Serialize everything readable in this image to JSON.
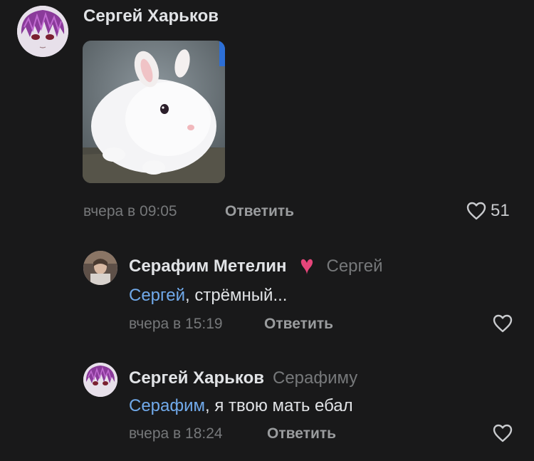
{
  "colors": {
    "background": "#19191a",
    "text": "#e1e3e6",
    "secondary": "#76787a",
    "link": "#71aaeb",
    "heart_badge": "#e6457a"
  },
  "comments": [
    {
      "author": "Сергей Харьков",
      "reply_to": "",
      "mention": "",
      "text": "",
      "has_photo": true,
      "photo_subject": "white-rabbit",
      "time": "вчера в 09:05",
      "reply_label": "Ответить",
      "likes": "51",
      "icon": "heart-outline-icon"
    },
    {
      "author": "Серафим Метелин",
      "badge_icon": "heart-badge-icon",
      "reply_to": "Сергей",
      "mention": "Сергей",
      "text": ", стрёмный...",
      "time": "вчера в 15:19",
      "reply_label": "Ответить",
      "likes": "",
      "icon": "heart-outline-icon"
    },
    {
      "author": "Сергей Харьков",
      "reply_to": "Серафиму",
      "mention": "Серафим",
      "text": ", я твою мать ебал",
      "time": "вчера в 18:24",
      "reply_label": "Ответить",
      "likes": "",
      "icon": "heart-outline-icon"
    }
  ]
}
